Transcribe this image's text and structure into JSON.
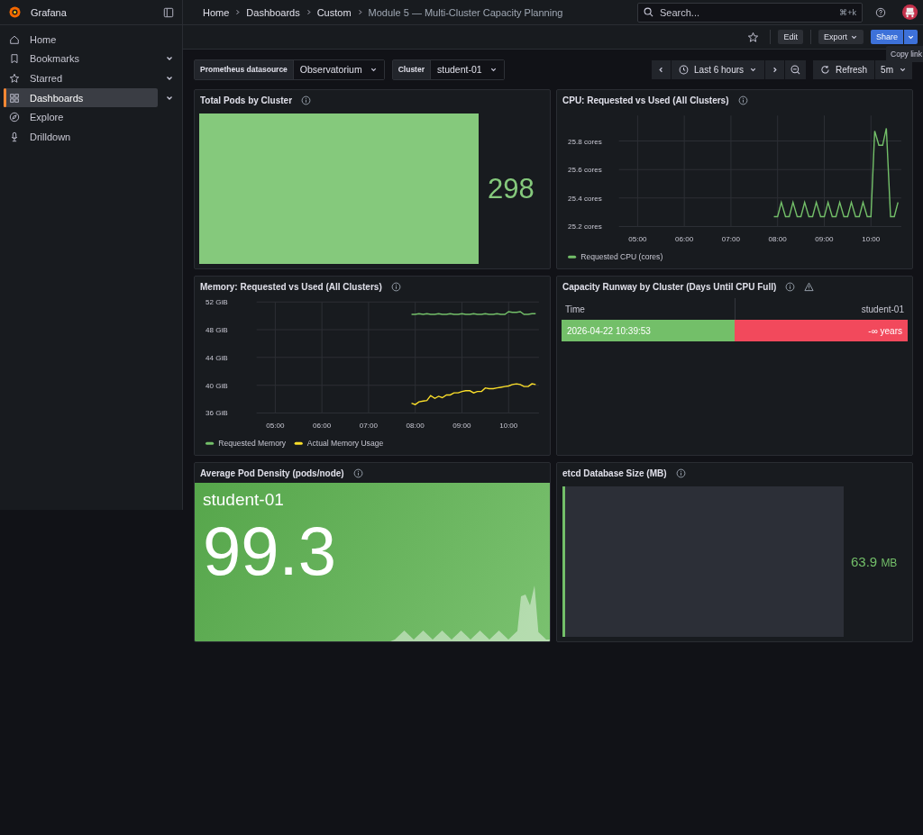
{
  "sidebar": {
    "brand": "Grafana",
    "items": [
      {
        "label": "Home",
        "expandable": false,
        "selected": false
      },
      {
        "label": "Bookmarks",
        "expandable": true,
        "selected": false
      },
      {
        "label": "Starred",
        "expandable": true,
        "selected": false
      },
      {
        "label": "Dashboards",
        "expandable": true,
        "selected": true
      },
      {
        "label": "Explore",
        "expandable": false,
        "selected": false
      },
      {
        "label": "Drilldown",
        "expandable": false,
        "selected": false
      }
    ]
  },
  "breadcrumbs": [
    "Home",
    "Dashboards",
    "Custom",
    "Module 5 — Multi-Cluster Capacity Planning"
  ],
  "search": {
    "placeholder": "Search...",
    "shortcut": "⌘+k"
  },
  "toolbar": {
    "edit": "Edit",
    "export": "Export",
    "share": "Share",
    "tooltip": "Copy link"
  },
  "variables": [
    {
      "label": "Prometheus datasource",
      "value": "Observatorium"
    },
    {
      "label": "Cluster",
      "value": "student-01"
    }
  ],
  "time_picker": {
    "range": "Last 6 hours",
    "refresh": "Refresh",
    "interval": "5m"
  },
  "panels": [
    {
      "kind": "bargauge",
      "title": "Total Pods by Cluster",
      "value": "298",
      "level": 1
    },
    {
      "kind": "timeseries",
      "title": "CPU: Requested vs Used (All Clusters)",
      "chart_data": {
        "type": "line",
        "grid": true,
        "legend": "bottom",
        "x": [
          7.92,
          8.0,
          8.08,
          8.17,
          8.25,
          8.33,
          8.42,
          8.5,
          8.58,
          8.67,
          8.75,
          8.83,
          8.92,
          9.0,
          9.08,
          9.17,
          9.25,
          9.33,
          9.42,
          9.5,
          9.58,
          9.67,
          9.75,
          9.83,
          9.92,
          10.0,
          10.08,
          10.17,
          10.25,
          10.33,
          10.42,
          10.5,
          10.58
        ],
        "series": [
          {
            "name": "Requested CPU (cores)",
            "color": "#73bf69",
            "values": [
              25.27,
              25.27,
              25.37,
              25.27,
              25.27,
              25.37,
              25.27,
              25.27,
              25.37,
              25.27,
              25.27,
              25.37,
              25.27,
              25.27,
              25.37,
              25.27,
              25.27,
              25.37,
              25.27,
              25.27,
              25.37,
              25.27,
              25.27,
              25.37,
              25.27,
              25.27,
              25.87,
              25.77,
              25.77,
              25.89,
              25.27,
              25.27,
              25.37
            ]
          }
        ],
        "xlim": [
          4.6,
          10.65
        ],
        "ylim": [
          25.2,
          25.98
        ],
        "xticks": [
          {
            "value": 5,
            "label": "05:00"
          },
          {
            "value": 6,
            "label": "06:00"
          },
          {
            "value": 7,
            "label": "07:00"
          },
          {
            "value": 8,
            "label": "08:00"
          },
          {
            "value": 9,
            "label": "09:00"
          },
          {
            "value": 10,
            "label": "10:00"
          }
        ],
        "yticks": [
          {
            "value": 25.2,
            "label": "25.2 cores"
          },
          {
            "value": 25.4,
            "label": "25.4 cores"
          },
          {
            "value": 25.6,
            "label": "25.6 cores"
          },
          {
            "value": 25.8,
            "label": "25.8 cores"
          }
        ]
      }
    },
    {
      "kind": "timeseries",
      "title": "Memory: Requested vs Used (All Clusters)",
      "chart_data": {
        "type": "line",
        "grid": true,
        "legend": "bottom",
        "x": [
          7.92,
          8.0,
          8.08,
          8.17,
          8.25,
          8.33,
          8.42,
          8.5,
          8.58,
          8.67,
          8.75,
          8.83,
          8.92,
          9.0,
          9.08,
          9.17,
          9.25,
          9.33,
          9.42,
          9.5,
          9.58,
          9.67,
          9.75,
          9.83,
          9.92,
          10.0,
          10.08,
          10.17,
          10.25,
          10.33,
          10.42,
          10.5,
          10.58
        ],
        "series": [
          {
            "name": "Requested Memory",
            "color": "#73bf69",
            "values": [
              50.2,
              50.2,
              50.3,
              50.2,
              50.3,
              50.2,
              50.2,
              50.3,
              50.2,
              50.2,
              50.3,
              50.2,
              50.2,
              50.3,
              50.2,
              50.2,
              50.3,
              50.2,
              50.2,
              50.3,
              50.2,
              50.2,
              50.3,
              50.2,
              50.2,
              50.6,
              50.5,
              50.5,
              50.6,
              50.2,
              50.2,
              50.3,
              50.3
            ]
          },
          {
            "name": "Actual Memory Usage",
            "color": "#fade2a",
            "values": [
              37.4,
              37.2,
              37.6,
              37.7,
              37.8,
              38.5,
              38.1,
              38.4,
              38.2,
              38.6,
              38.6,
              38.9,
              38.9,
              39.1,
              39.2,
              39.2,
              38.9,
              39.1,
              39.1,
              39.6,
              39.5,
              39.5,
              39.6,
              39.7,
              39.8,
              39.9,
              40.1,
              40.2,
              40.1,
              39.8,
              39.8,
              40.2,
              40.1
            ]
          }
        ],
        "xlim": [
          4.6,
          10.65
        ],
        "ylim": [
          36,
          52
        ],
        "xticks": [
          {
            "value": 5,
            "label": "05:00"
          },
          {
            "value": 6,
            "label": "06:00"
          },
          {
            "value": 7,
            "label": "07:00"
          },
          {
            "value": 8,
            "label": "08:00"
          },
          {
            "value": 9,
            "label": "09:00"
          },
          {
            "value": 10,
            "label": "10:00"
          }
        ],
        "yticks": [
          {
            "value": 36,
            "label": "36 GiB"
          },
          {
            "value": 40,
            "label": "40 GiB"
          },
          {
            "value": 44,
            "label": "44 GiB"
          },
          {
            "value": 48,
            "label": "48 GiB"
          },
          {
            "value": 52,
            "label": "52 GiB"
          }
        ]
      }
    },
    {
      "kind": "table",
      "title": "Capacity Runway by Cluster (Days Until CPU Full)",
      "warning": true,
      "columns": [
        "Time",
        "student-01"
      ],
      "rows": [
        [
          {
            "text": "2026-04-22 10:39:53",
            "color": "#73bf69"
          },
          {
            "text": "-∞ years",
            "color": "#f2495c"
          }
        ]
      ]
    },
    {
      "kind": "stat",
      "title": "Average Pod Density (pods/node)",
      "label": "student-01",
      "value": "99.3"
    },
    {
      "kind": "gauge",
      "title": "etcd Database Size (MB)",
      "value": "63.9",
      "unit": "MB",
      "level": 0.01
    }
  ]
}
